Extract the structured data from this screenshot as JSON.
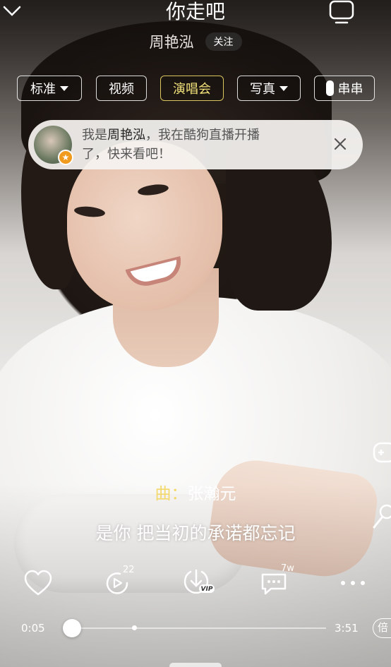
{
  "header": {
    "song_title": "你走吧",
    "artist": "周艳泓",
    "follow_label": "关注"
  },
  "modes": [
    {
      "label": "标准",
      "has_dropdown": true,
      "active": false
    },
    {
      "label": "视频",
      "has_dropdown": false,
      "active": false
    },
    {
      "label": "演唱会",
      "has_dropdown": false,
      "active": true
    },
    {
      "label": "写真",
      "has_dropdown": true,
      "active": false
    },
    {
      "label": "串串",
      "has_dropdown": false,
      "active": false
    }
  ],
  "notification": {
    "prefix": "我是",
    "name": "周艳泓",
    "message_line1_rest": "，我在酷狗直播开播",
    "message_line2": "了，快来看吧！"
  },
  "lyrics": {
    "credit_key": "曲：",
    "credit_value": "张瀚元",
    "current_line": "是你 把当初的承诺都忘记"
  },
  "actions": {
    "comment_like_count": "22",
    "comment_count": "7w",
    "vip_label": "VIP"
  },
  "progress": {
    "elapsed": "0:05",
    "total": "3:51",
    "played_fraction": 0.02,
    "speed_label": "倍"
  },
  "colors": {
    "accent_active": "#f2e27a",
    "credit_key": "#f3d86b",
    "badge": "#f09a1e"
  },
  "icons": [
    "chevron-down-icon",
    "tv-icon",
    "close-icon",
    "heart-icon",
    "replay-comment-icon",
    "download-icon",
    "comment-icon",
    "more-icon",
    "game-icon",
    "mic-icon"
  ]
}
